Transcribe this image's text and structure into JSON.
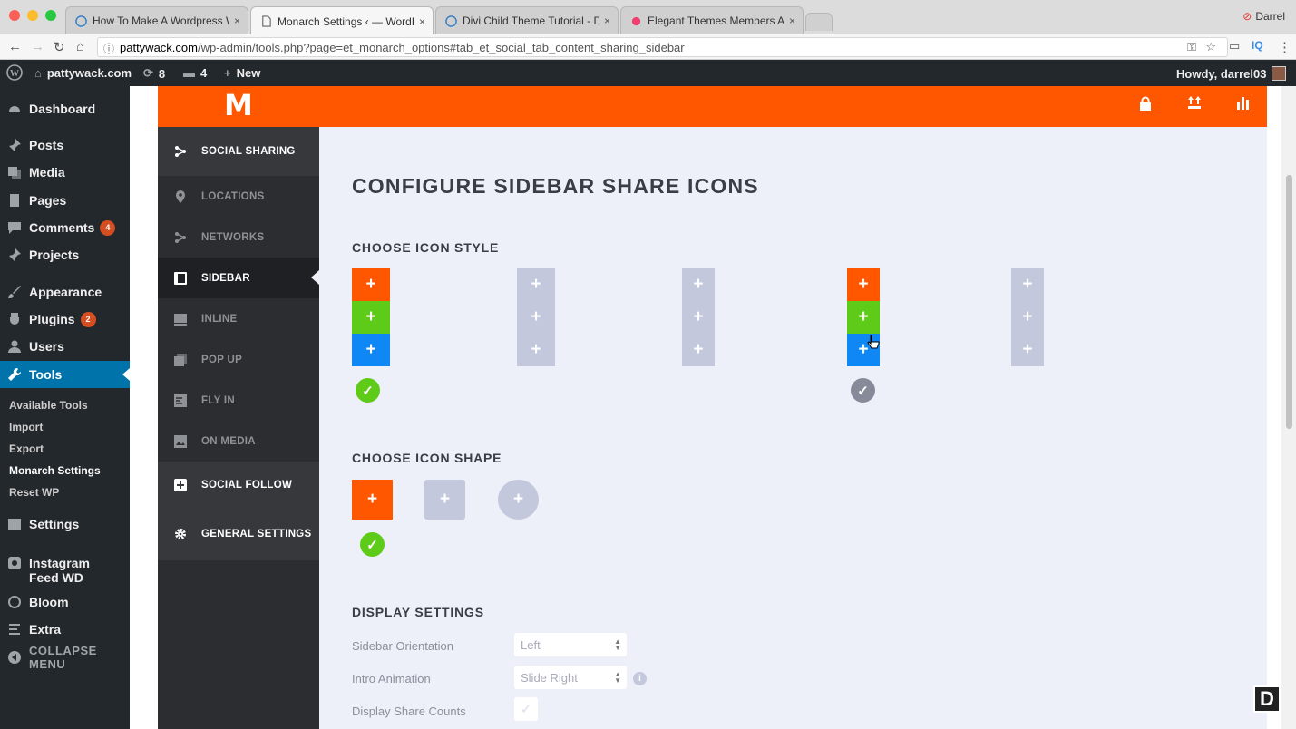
{
  "browser": {
    "tabs": [
      {
        "label": "How To Make A Wordpress We",
        "close": "×"
      },
      {
        "label": "Monarch Settings ‹ — WordPre",
        "close": "×"
      },
      {
        "label": "Divi Child Theme Tutorial - Divi",
        "close": "×"
      },
      {
        "label": "Elegant Themes Members Area",
        "close": "×"
      }
    ],
    "user": "Darrel",
    "url_domain": "pattywack.com",
    "url_path": "/wp-admin/tools.php?page=et_monarch_options#tab_et_social_tab_content_sharing_sidebar",
    "ext_label": "IQ"
  },
  "adminbar": {
    "site": "pattywack.com",
    "updates": "8",
    "comments": "4",
    "new": "New",
    "howdy": "Howdy, darrel03"
  },
  "wpmenu": {
    "dashboard": "Dashboard",
    "posts": "Posts",
    "media": "Media",
    "pages": "Pages",
    "comments": "Comments",
    "comments_badge": "4",
    "projects": "Projects",
    "appearance": "Appearance",
    "plugins": "Plugins",
    "plugins_badge": "2",
    "users": "Users",
    "tools": "Tools",
    "sub": [
      "Available Tools",
      "Import",
      "Export",
      "Monarch Settings",
      "Reset WP"
    ],
    "settings": "Settings",
    "instagram": "Instagram Feed WD",
    "bloom": "Bloom",
    "extra": "Extra",
    "collapse": "COLLAPSE MENU"
  },
  "monarch": {
    "logo": "M",
    "nav": {
      "social_sharing": "SOCIAL SHARING",
      "locations": "LOCATIONS",
      "networks": "NETWORKS",
      "sidebar": "SIDEBAR",
      "inline": "INLINE",
      "popup": "POP UP",
      "flyin": "FLY IN",
      "onmedia": "ON MEDIA",
      "social_follow": "SOCIAL FOLLOW",
      "general": "GENERAL SETTINGS"
    },
    "title": "CONFIGURE SIDEBAR SHARE ICONS",
    "icon_style_heading": "CHOOSE ICON STYLE",
    "icon_shape_heading": "CHOOSE ICON SHAPE",
    "display_heading": "DISPLAY SETTINGS",
    "plus": "+",
    "check": "✓",
    "settings": {
      "orientation_label": "Sidebar Orientation",
      "orientation_value": "Left",
      "animation_label": "Intro Animation",
      "animation_value": "Slide Right",
      "counts_label": "Display Share Counts",
      "info": "i"
    },
    "colors": {
      "orange": "#ff5600",
      "green": "#5fcb19",
      "blue": "#0f87f5",
      "gray": "#c3c8dd",
      "check_gray": "#868a99"
    }
  },
  "watermark": "D"
}
